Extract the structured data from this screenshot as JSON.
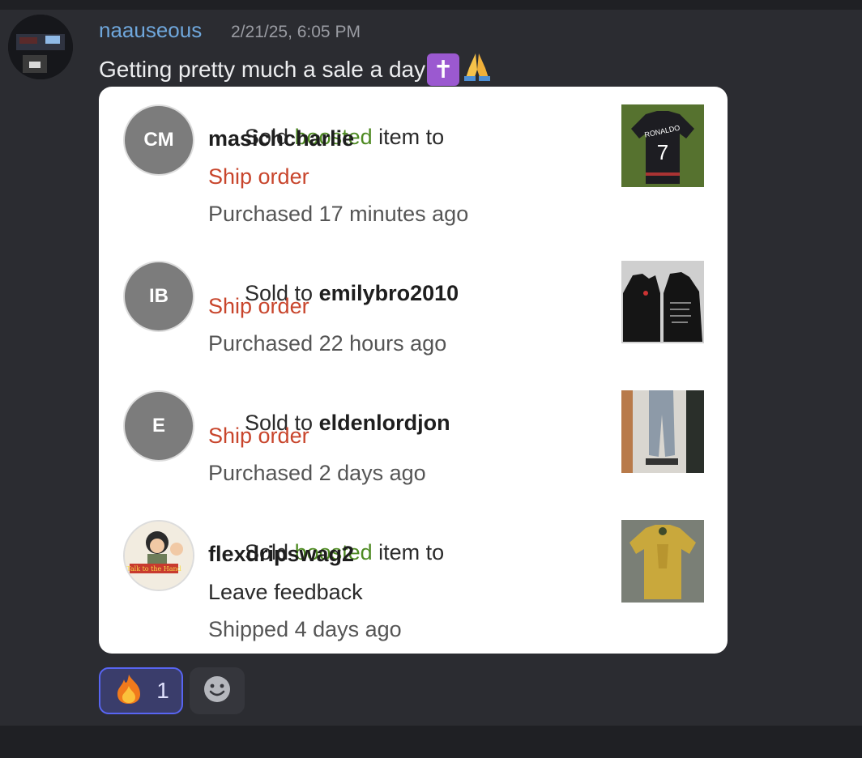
{
  "message": {
    "author": "naauseous",
    "timestamp": "2/21/25, 6:05 PM",
    "text": "Getting pretty much a sale a day",
    "emojis": [
      "latin-cross",
      "folded-hands"
    ]
  },
  "sales": [
    {
      "avatar_initials": "CM",
      "prefix": "Sold ",
      "boosted": "boosted",
      "suffix": " item to",
      "buyer": "masichcharlie",
      "action": "Ship order",
      "status": "Purchased 17 minutes ago",
      "thumb_icon": "black-ronaldo-7-jersey"
    },
    {
      "avatar_initials": "IB",
      "prefix": "Sold to ",
      "buyer": "emilybro2010",
      "action": "Ship order",
      "status": "Purchased 22 hours ago",
      "thumb_icon": "black-hoodies"
    },
    {
      "avatar_initials": "E",
      "prefix": "Sold to ",
      "buyer": "eldenlordjon",
      "action": "Ship order",
      "status": "Purchased 2 days ago",
      "thumb_icon": "baggy-jeans"
    },
    {
      "avatar_icon": "cartoon-avatar",
      "prefix": "Sold ",
      "boosted": "boosted",
      "suffix": " item to",
      "buyer": "flexdripswag2",
      "action": "Leave feedback",
      "status": "Shipped 4 days ago",
      "thumb_icon": "gold-jersey"
    }
  ],
  "reactions": [
    {
      "emoji": "fire",
      "count": "1"
    }
  ],
  "add_reaction_icon": "smiley-icon",
  "colors": {
    "username": "#6fa7dc",
    "boosted": "#4e8a22",
    "action": "#c8452c",
    "reaction_border": "#5865f2"
  }
}
